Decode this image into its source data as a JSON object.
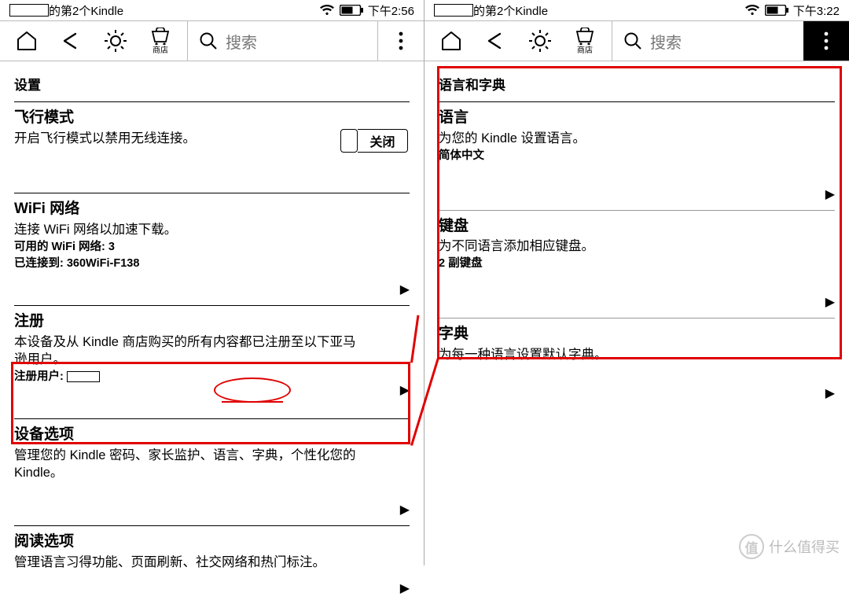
{
  "left": {
    "status": {
      "user_suffix": "的第2个Kindle",
      "time": "下午2:56"
    },
    "toolbar": {
      "shop_label": "商店",
      "search_placeholder": "搜索"
    },
    "header": "设置",
    "sections": {
      "airplane": {
        "title": "飞行模式",
        "desc": "开启飞行模式以禁用无线连接。",
        "toggle": "关闭"
      },
      "wifi": {
        "title": "WiFi 网络",
        "desc": "连接 WiFi 网络以加速下载。",
        "meta1": "可用的 WiFi 网络: 3",
        "meta2": "已连接到: 360WiFi-F138"
      },
      "reg": {
        "title": "注册",
        "desc": "本设备及从 Kindle 商店购买的所有内容都已注册至以下亚马逊用户。",
        "meta_prefix": "注册用户: "
      },
      "device": {
        "title": "设备选项",
        "desc_pre": "管理您的 Kindle 密码、家长监护、",
        "desc_hl": "语言、字典，",
        "desc_post": "个性化您的 Kindle。"
      },
      "reading": {
        "title": "阅读选项",
        "desc": "管理语言习得功能、页面刷新、社交网络和热门标注。"
      }
    }
  },
  "right": {
    "status": {
      "user_suffix": "的第2个Kindle",
      "time": "下午3:22"
    },
    "toolbar": {
      "shop_label": "商店",
      "search_placeholder": "搜索"
    },
    "header": "语言和字典",
    "sections": {
      "lang": {
        "title": "语言",
        "desc": "为您的 Kindle 设置语言。",
        "meta": "简体中文"
      },
      "keyboard": {
        "title": "键盘",
        "desc": "为不同语言添加相应键盘。",
        "meta": "2 副键盘"
      },
      "dict": {
        "title": "字典",
        "desc": "为每一种语言设置默认字典。"
      }
    }
  },
  "watermark": {
    "badge": "值",
    "text": "什么值得买"
  },
  "colors": {
    "annotation": "#e00000"
  }
}
